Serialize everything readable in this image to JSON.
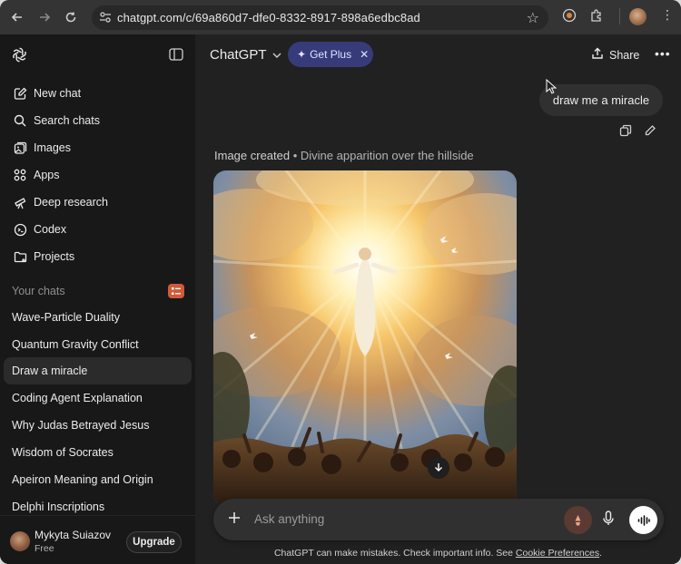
{
  "browser": {
    "url": "chatgpt.com/c/69a860d7-dfe0-8332-8917-898a6edbc8ad"
  },
  "sidebar": {
    "primary": [
      {
        "label": "New chat",
        "icon": "new-chat-icon"
      },
      {
        "label": "Search chats",
        "icon": "search-icon"
      },
      {
        "label": "Images",
        "icon": "images-icon"
      },
      {
        "label": "Apps",
        "icon": "apps-icon"
      },
      {
        "label": "Deep research",
        "icon": "telescope-icon"
      },
      {
        "label": "Codex",
        "icon": "codex-icon"
      },
      {
        "label": "Projects",
        "icon": "folder-icon"
      }
    ],
    "section_title": "Your chats",
    "chats": [
      {
        "label": "Wave-Particle Duality"
      },
      {
        "label": "Quantum Gravity Conflict"
      },
      {
        "label": "Draw a miracle",
        "active": true
      },
      {
        "label": "Coding Agent Explanation"
      },
      {
        "label": "Why Judas Betrayed Jesus"
      },
      {
        "label": "Wisdom of Socrates"
      },
      {
        "label": "Apeiron Meaning and Origin"
      },
      {
        "label": "Delphi Inscriptions"
      }
    ],
    "user": {
      "name": "Mykyta Suiazov",
      "plan": "Free",
      "upgrade_label": "Upgrade"
    }
  },
  "header": {
    "model": "ChatGPT",
    "get_plus": "Get Plus",
    "share": "Share"
  },
  "conversation": {
    "user_message": "draw me a miracle",
    "caption_strong": "Image created",
    "caption_sep": " • ",
    "caption_rest": "Divine apparition over the hillside"
  },
  "composer": {
    "placeholder": "Ask anything"
  },
  "footer": {
    "disclaimer_prefix": "ChatGPT can make mistakes. Check important info. See ",
    "link": "Cookie Preferences",
    "suffix": "."
  },
  "colors": {
    "accent_plus": "#373b7a",
    "sidebar_bg": "#181818",
    "main_bg": "#212121",
    "badge": "#d05a3a"
  }
}
